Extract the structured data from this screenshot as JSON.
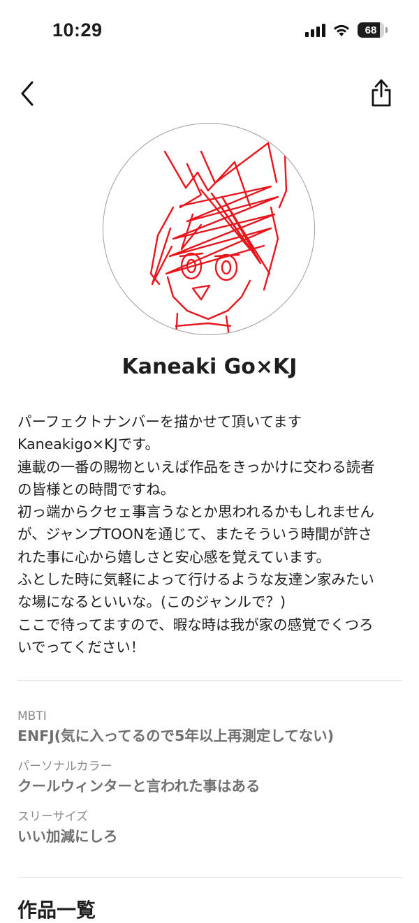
{
  "status_bar": {
    "time": "10:29",
    "battery_level": "68",
    "signal_icon": "cellular-signal-icon",
    "wifi_icon": "wifi-icon"
  },
  "nav": {
    "back_icon": "chevron-left-icon",
    "share_icon": "share-icon"
  },
  "profile": {
    "avatar_icon": "sketch-portrait-avatar",
    "avatar_color": "#e8151c",
    "name": "Kaneaki Go×KJ",
    "bio_lines": [
      "パーフェクトナンバーを描かせて頂いてます",
      "Kaneakigo×KJです。",
      "連載の一番の賜物といえば作品をきっかけに交わる読者",
      "の皆様との時間ですね。",
      "初っ端からクセェ事言うなとか思われるかもしれません",
      "が、ジャンプTOONを通じて、またそういう時間が許さ",
      "れた事に心から嬉しさと安心感を覚えています。",
      "ふとした時に気軽によって行けるような友達ン家みたい",
      "な場になるといいな。(このジャンルで？)",
      "ここで待ってますので、暇な時は我が家の感覚でくつろ",
      "いでってください！"
    ]
  },
  "attributes": [
    {
      "label": "MBTI",
      "value": "ENFJ(気に入ってるので5年以上再測定してない)"
    },
    {
      "label": "パーソナルカラー",
      "value": "クールウィンターと言われた事はある"
    },
    {
      "label": "スリーサイズ",
      "value": "いい加減にしろ"
    }
  ],
  "works_section": {
    "title": "作品一覧"
  }
}
